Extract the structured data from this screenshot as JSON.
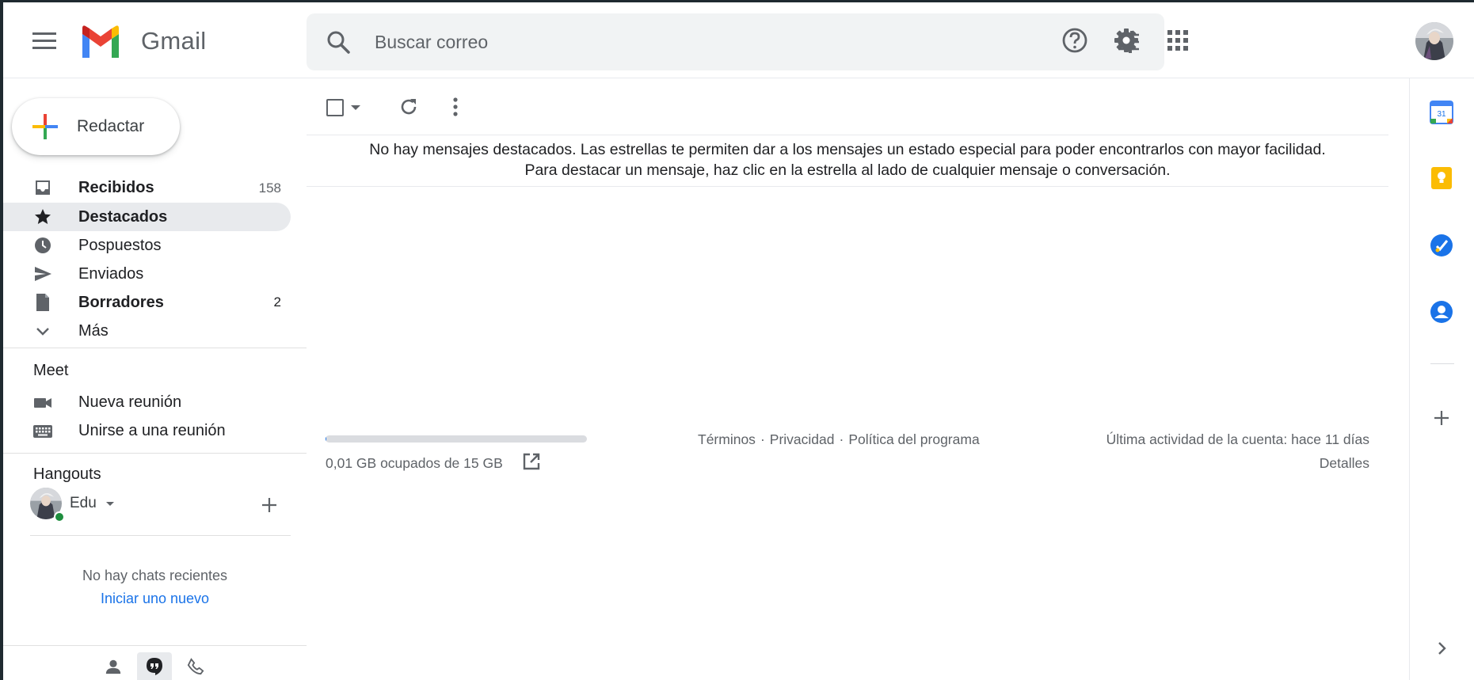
{
  "header": {
    "app_name": "Gmail",
    "search_placeholder": "Buscar correo"
  },
  "sidebar": {
    "compose_label": "Redactar",
    "items": [
      {
        "label": "Recibidos",
        "count": "158",
        "bold": true,
        "icon": "inbox-icon"
      },
      {
        "label": "Destacados",
        "count": "",
        "bold": true,
        "icon": "star-icon",
        "active": true
      },
      {
        "label": "Pospuestos",
        "count": "",
        "bold": false,
        "icon": "clock-icon"
      },
      {
        "label": "Enviados",
        "count": "",
        "bold": false,
        "icon": "send-icon"
      },
      {
        "label": "Borradores",
        "count": "2",
        "bold": true,
        "icon": "draft-icon"
      },
      {
        "label": "Más",
        "count": "",
        "bold": false,
        "icon": "chevron-down-icon"
      }
    ],
    "meet": {
      "title": "Meet",
      "new_meeting": "Nueva reunión",
      "join_meeting": "Unirse a una reunión"
    },
    "hangouts": {
      "title": "Hangouts",
      "user_name": "Edu",
      "no_chats": "No hay chats recientes",
      "start_new": "Iniciar uno nuevo"
    }
  },
  "main": {
    "empty_line1": "No hay mensajes destacados. Las estrellas te permiten dar a los mensajes un estado especial para poder encontrarlos con mayor facilidad.",
    "empty_line2": "Para destacar un mensaje, haz clic en la estrella al lado de cualquier mensaje o conversación."
  },
  "footer": {
    "storage_text": "0,01 GB ocupados de 15 GB",
    "storage_fraction": 0.001,
    "terms": "Términos",
    "privacy": "Privacidad",
    "policy": "Política del programa",
    "separator": "·",
    "last_activity": "Última actividad de la cuenta: hace 11 días",
    "details": "Detalles"
  },
  "side_panel": {
    "calendar_day": "31"
  },
  "colors": {
    "accent_blue": "#1a73e8",
    "active_bg": "#e8eaed",
    "online_green": "#1e8e3e"
  }
}
